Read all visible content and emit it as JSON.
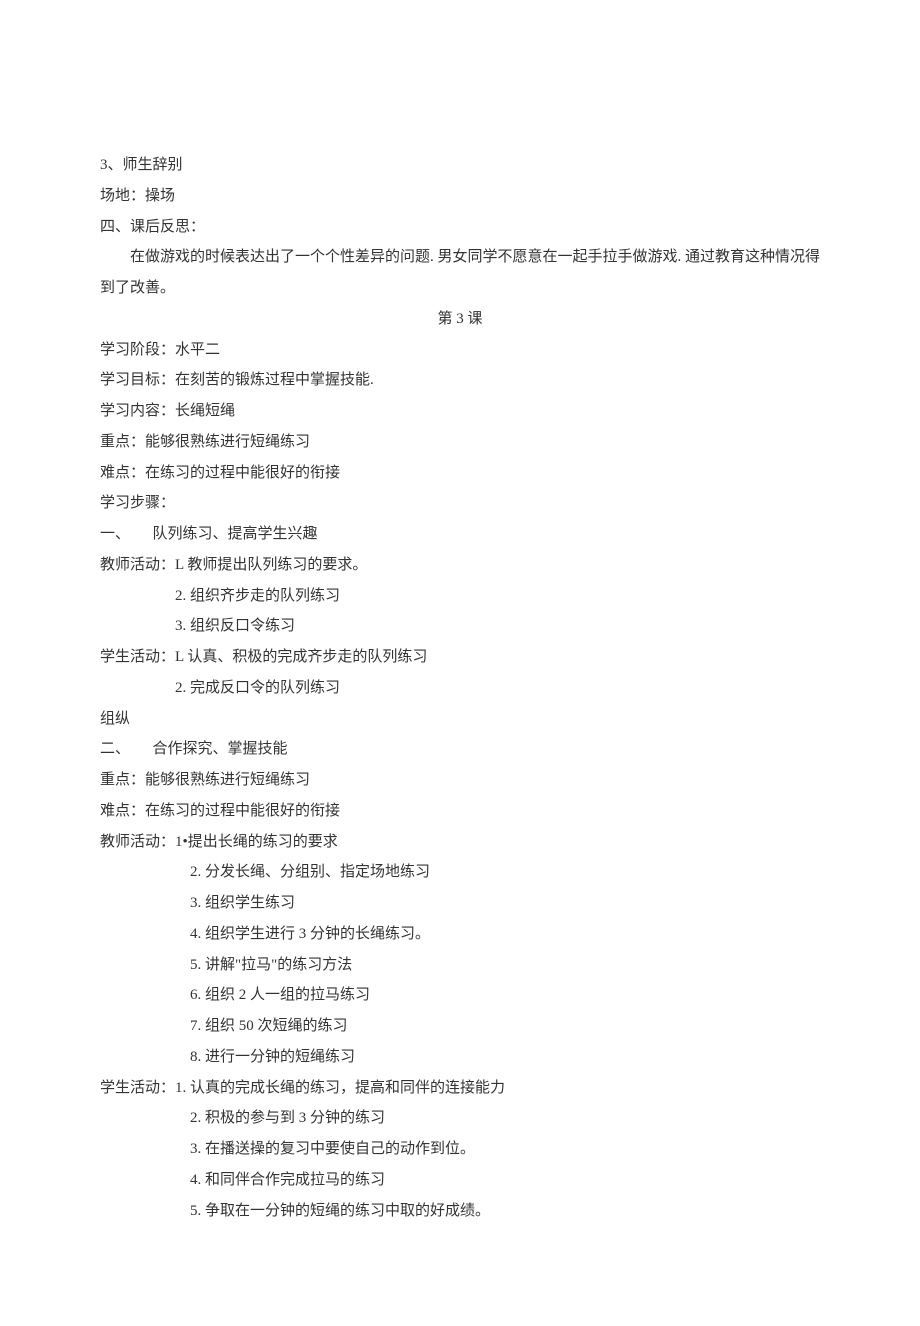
{
  "lines": {
    "l1": "3、师生辞别",
    "l2": "场地：操场",
    "l3": "四、课后反思：",
    "l4": "在做游戏的时候表达出了一个个性差异的问题. 男女同学不愿意在一起手拉手做游戏. 通过教育这种情况得到了改善。",
    "l5": "第 3 课",
    "l6": "学习阶段：水平二",
    "l7": "学习目标：在刻苦的锻炼过程中掌握技能.",
    "l8": "学习内容：长绳短绳",
    "l9": "重点：能够很熟练进行短绳练习",
    "l10": "难点：在练习的过程中能很好的衔接",
    "l11": "学习步骤：",
    "l12": "一、　　队列练习、提高学生兴趣",
    "l13": "教师活动：L 教师提出队列练习的要求。",
    "l14": "2. 组织齐步走的队列练习",
    "l15": "3. 组织反口令练习",
    "l16": "学生活动：L 认真、积极的完成齐步走的队列练习",
    "l17": "2. 完成反口令的队列练习",
    "l18": "组纵",
    "l19": "二、　　合作探究、掌握技能",
    "l20": "重点：能够很熟练进行短绳练习",
    "l21": "难点：在练习的过程中能很好的衔接",
    "l22": "教师活动：1•提出长绳的练习的要求",
    "l23": "2. 分发长绳、分组别、指定场地练习",
    "l24": "3. 组织学生练习",
    "l25": "4. 组织学生进行 3 分钟的长绳练习。",
    "l26": "5. 讲解\"拉马\"的练习方法",
    "l27": "6. 组织 2 人一组的拉马练习",
    "l28": "7. 组织 50 次短绳的练习",
    "l29": "8. 进行一分钟的短绳练习",
    "l30": "学生活动：1. 认真的完成长绳的练习，提高和同伴的连接能力",
    "l31": "2. 积极的参与到 3 分钟的练习",
    "l32": "3. 在播送操的复习中要使自己的动作到位。",
    "l33": "4. 和同伴合作完成拉马的练习",
    "l34": "5. 争取在一分钟的短绳的练习中取的好成绩。"
  }
}
